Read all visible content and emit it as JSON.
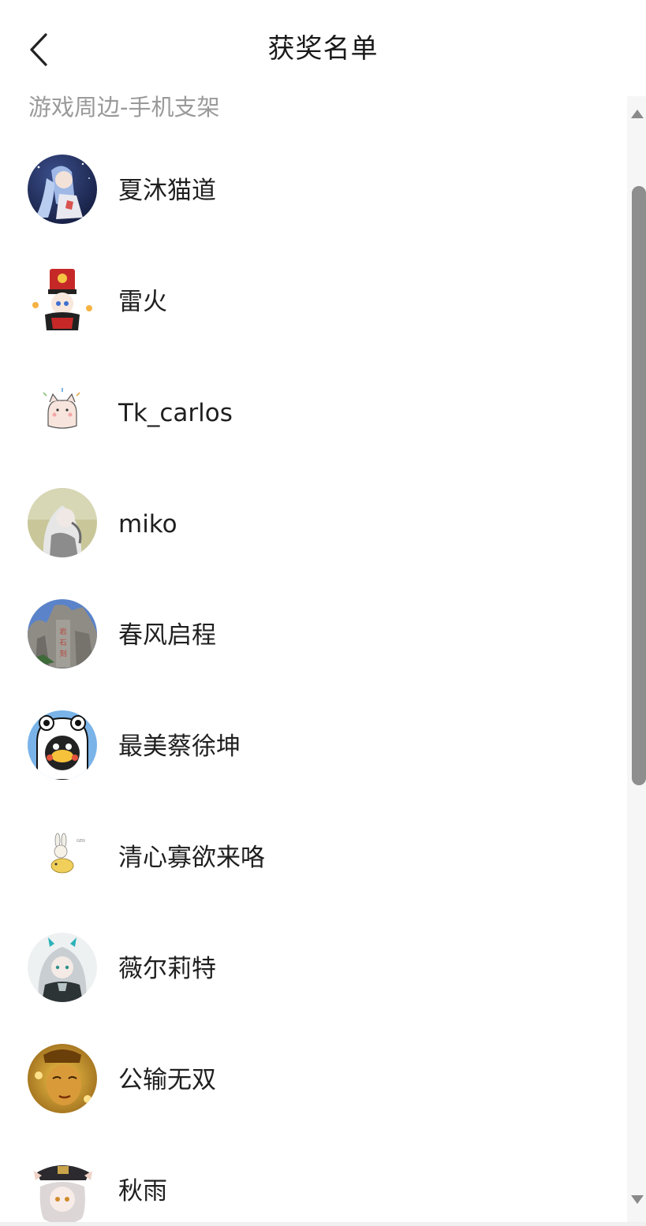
{
  "header": {
    "title": "获奖名单"
  },
  "section": {
    "label": "游戏周边-手机支架"
  },
  "winners": [
    {
      "name": "夏沐猫道",
      "avatar": "anime-girl-night-avatar"
    },
    {
      "name": "雷火",
      "avatar": "chibi-hat-character-avatar"
    },
    {
      "name": "Tk_carlos",
      "avatar": "cute-cat-sticker-avatar"
    },
    {
      "name": "miko",
      "avatar": "white-haired-anime-avatar"
    },
    {
      "name": "春风启程",
      "avatar": "carved-rock-landscape-avatar"
    },
    {
      "name": "最美蔡徐坤",
      "avatar": "duck-in-frog-hat-avatar"
    },
    {
      "name": "清心寡欲来咯",
      "avatar": "bunny-riding-creature-avatar"
    },
    {
      "name": "薇尔莉特",
      "avatar": "silver-haired-girl-avatar"
    },
    {
      "name": "公输无双",
      "avatar": "golden-mask-avatar"
    },
    {
      "name": "秋雨",
      "avatar": "officer-cap-chibi-avatar"
    }
  ],
  "colors": {
    "title": "#1a1a1a",
    "section_label": "#9a9a9a",
    "name": "#1f1f1f",
    "scroll_thumb": "#8e8e8e"
  }
}
